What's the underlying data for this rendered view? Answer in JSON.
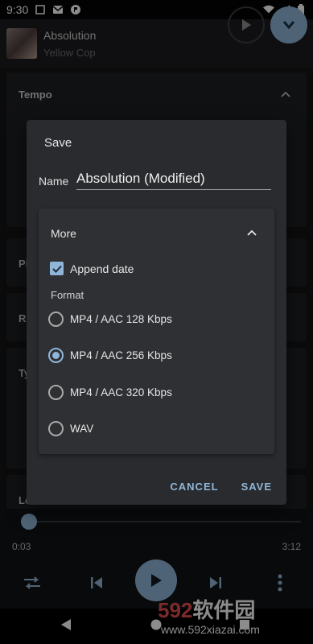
{
  "status_bar": {
    "time": "9:30"
  },
  "now_playing": {
    "title": "Absolution",
    "artist": "Yellow Cop"
  },
  "background": {
    "tempo_title": "Tempo",
    "card2_letters": "Pi",
    "card3_letters": "Ra",
    "card4_letters": "Ty",
    "card5_letters": "Lo"
  },
  "dialog": {
    "title": "Save",
    "name_label": "Name",
    "name_value": "Absolution (Modified)",
    "more": {
      "title": "More",
      "append_date_label": "Append date",
      "append_date_checked": true,
      "format_label": "Format",
      "options": [
        {
          "label": "MP4 / AAC 128 Kbps",
          "selected": false
        },
        {
          "label": "MP4 / AAC 256 Kbps",
          "selected": true
        },
        {
          "label": "MP4 / AAC 320 Kbps",
          "selected": false
        },
        {
          "label": "WAV",
          "selected": false
        }
      ]
    },
    "cancel_label": "CANCEL",
    "save_label": "SAVE"
  },
  "player": {
    "current_time": "0:03",
    "total_time": "3:12",
    "progress": 0.016
  },
  "watermark": {
    "brand_number": "592",
    "brand_text": "软件园",
    "url": "www.592xiazai.com"
  },
  "colors": {
    "accent": "#8fb6d8",
    "dialog_bg": "#2a2b2e",
    "panel_bg": "#2f3033"
  }
}
